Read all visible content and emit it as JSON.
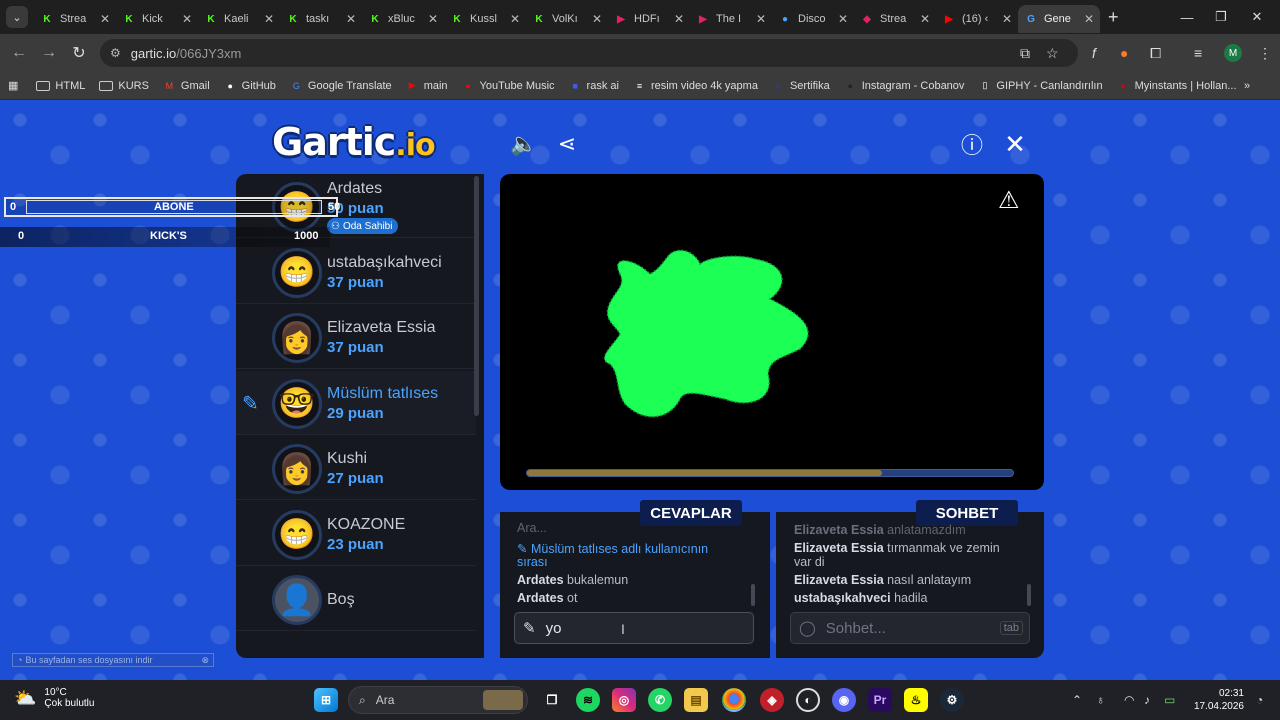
{
  "browser": {
    "tabs": [
      {
        "label": "Strea",
        "color": "#53fc18",
        "glyph": "K"
      },
      {
        "label": "Kick",
        "color": "#53fc18",
        "glyph": "K"
      },
      {
        "label": "Kaeli",
        "color": "#53fc18",
        "glyph": "K"
      },
      {
        "label": "taskı",
        "color": "#53fc18",
        "glyph": "K"
      },
      {
        "label": "xBluc",
        "color": "#53fc18",
        "glyph": "K"
      },
      {
        "label": "Kussl",
        "color": "#53fc18",
        "glyph": "K"
      },
      {
        "label": "VolKı",
        "color": "#53fc18",
        "glyph": "K"
      },
      {
        "label": "HDFı",
        "color": "#e0245e",
        "glyph": "▶"
      },
      {
        "label": "The I",
        "color": "#e0245e",
        "glyph": "▶"
      },
      {
        "label": "Disco",
        "color": "#4aa3ff",
        "glyph": "●"
      },
      {
        "label": "Strea",
        "color": "#e0245e",
        "glyph": "◆"
      },
      {
        "label": "(16) ‹",
        "color": "#ff0000",
        "glyph": "▶"
      },
      {
        "label": "Gene",
        "color": "#4aa3ff",
        "glyph": "G",
        "active": true
      }
    ],
    "url_host": "gartic.io",
    "url_path": "/066JY3xm",
    "profile_initial": "M",
    "bookmarks": [
      {
        "label": "HTML",
        "type": "folder"
      },
      {
        "label": "KURS",
        "type": "folder"
      },
      {
        "label": "Gmail",
        "icon_color": "#ea4335",
        "glyph": "M"
      },
      {
        "label": "GitHub",
        "icon_color": "#ffffff",
        "glyph": "●"
      },
      {
        "label": "Google Translate",
        "icon_color": "#4285f4",
        "glyph": "G"
      },
      {
        "label": "main",
        "icon_color": "#ff0000",
        "glyph": "▶"
      },
      {
        "label": "YouTube Music",
        "icon_color": "#ff0000",
        "glyph": "●"
      },
      {
        "label": "rask ai",
        "icon_color": "#3a5cff",
        "glyph": "■"
      },
      {
        "label": "resim video 4k yapma",
        "icon_color": "#ffffff",
        "glyph": "≡"
      },
      {
        "label": "Sertifika",
        "icon_color": "#2a3b8f",
        "glyph": "●"
      },
      {
        "label": "Instagram - Cobanov",
        "icon_color": "#222222",
        "glyph": "●"
      },
      {
        "label": "GIPHY - Canlandırılın",
        "icon_color": "#ffffff",
        "glyph": "▯"
      },
      {
        "label": "Myinstants | Hollan...",
        "icon_color": "#d0021b",
        "glyph": "●"
      }
    ]
  },
  "game": {
    "logo_main": "Gartic",
    "logo_suffix": ".io",
    "players": [
      {
        "name": "Ardates",
        "points": "50 puan",
        "avatar": "😁",
        "badge": "Oda Sahibi"
      },
      {
        "name": "ustabaşıkahveci",
        "points": "37 puan",
        "avatar": "😁"
      },
      {
        "name": "Elizaveta Essia",
        "points": "37 puan",
        "avatar": "👩"
      },
      {
        "name": "Müslüm tatlıses",
        "points": "29 puan",
        "avatar": "🤓",
        "drawing": true
      },
      {
        "name": "Kushi",
        "points": "27 puan",
        "avatar": "👩"
      },
      {
        "name": "KOAZONE",
        "points": "23 puan",
        "avatar": "😁"
      },
      {
        "name": "Boş",
        "points": "",
        "avatar": "👤",
        "empty": true
      }
    ],
    "overlay": {
      "row1_left": "0",
      "row1_center": "ABONE",
      "row1_right": "50",
      "row2_left": "0",
      "row2_center": "KICK'S",
      "row2_right": "1000"
    },
    "round_progress": 0.73,
    "answers": {
      "title": "CEVAPLAR",
      "messages": [
        {
          "text": "Ara...",
          "style": "faded"
        },
        {
          "text": "Müslüm tatlıses adlı kullanıcının",
          "style": "sys"
        },
        {
          "text": "sırası",
          "style": "sys"
        },
        {
          "name": "Ardates",
          "text": "bukalemun"
        },
        {
          "name": "Ardates",
          "text": "ot"
        }
      ],
      "input_value": "yo"
    },
    "chat": {
      "title": "SOHBET",
      "messages": [
        {
          "name": "Elizaveta Essia",
          "text": "anlatamazdım",
          "style": "faded"
        },
        {
          "name": "Elizaveta Essia",
          "text": "tırmanmak ve zemin"
        },
        {
          "text": "var di"
        },
        {
          "name": "Elizaveta Essia",
          "text": "nasıl anlatayım"
        },
        {
          "name": "ustabaşıkahveci",
          "text": "hadila"
        }
      ],
      "placeholder": "Sohbet...",
      "tab_hint": "tab"
    },
    "download_hint": "Bu sayfadan ses dosyasını indir"
  },
  "taskbar": {
    "temperature": "10°C",
    "weather": "Çok bulutlu",
    "search_label": "Ara",
    "time": "02:31",
    "date": "17.04.2026"
  }
}
